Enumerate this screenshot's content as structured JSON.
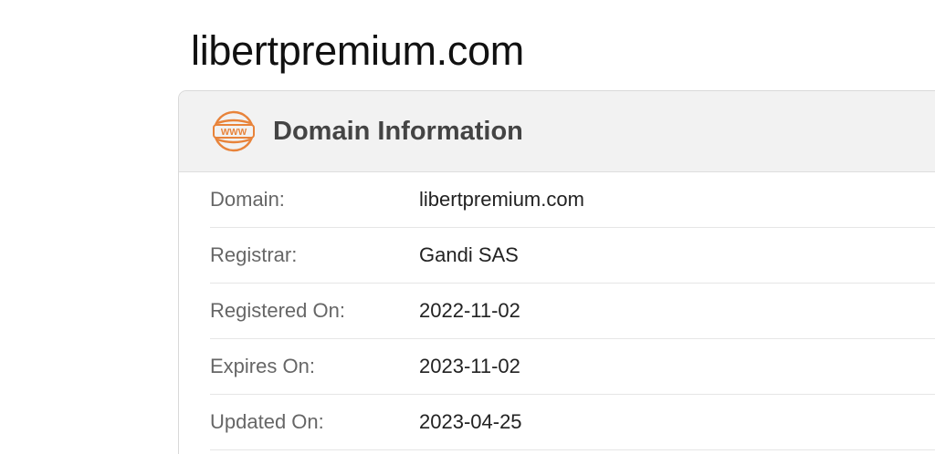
{
  "page": {
    "title": "libertpremium.com"
  },
  "card": {
    "icon": "www-globe-icon",
    "icon_text": "WWW",
    "accent_color": "#e8833a",
    "title": "Domain Information"
  },
  "rows": [
    {
      "label": "Domain:",
      "value": "libertpremium.com"
    },
    {
      "label": "Registrar:",
      "value": "Gandi SAS"
    },
    {
      "label": "Registered On:",
      "value": "2022-11-02"
    },
    {
      "label": "Expires On:",
      "value": "2023-11-02"
    },
    {
      "label": "Updated On:",
      "value": "2023-04-25"
    }
  ]
}
